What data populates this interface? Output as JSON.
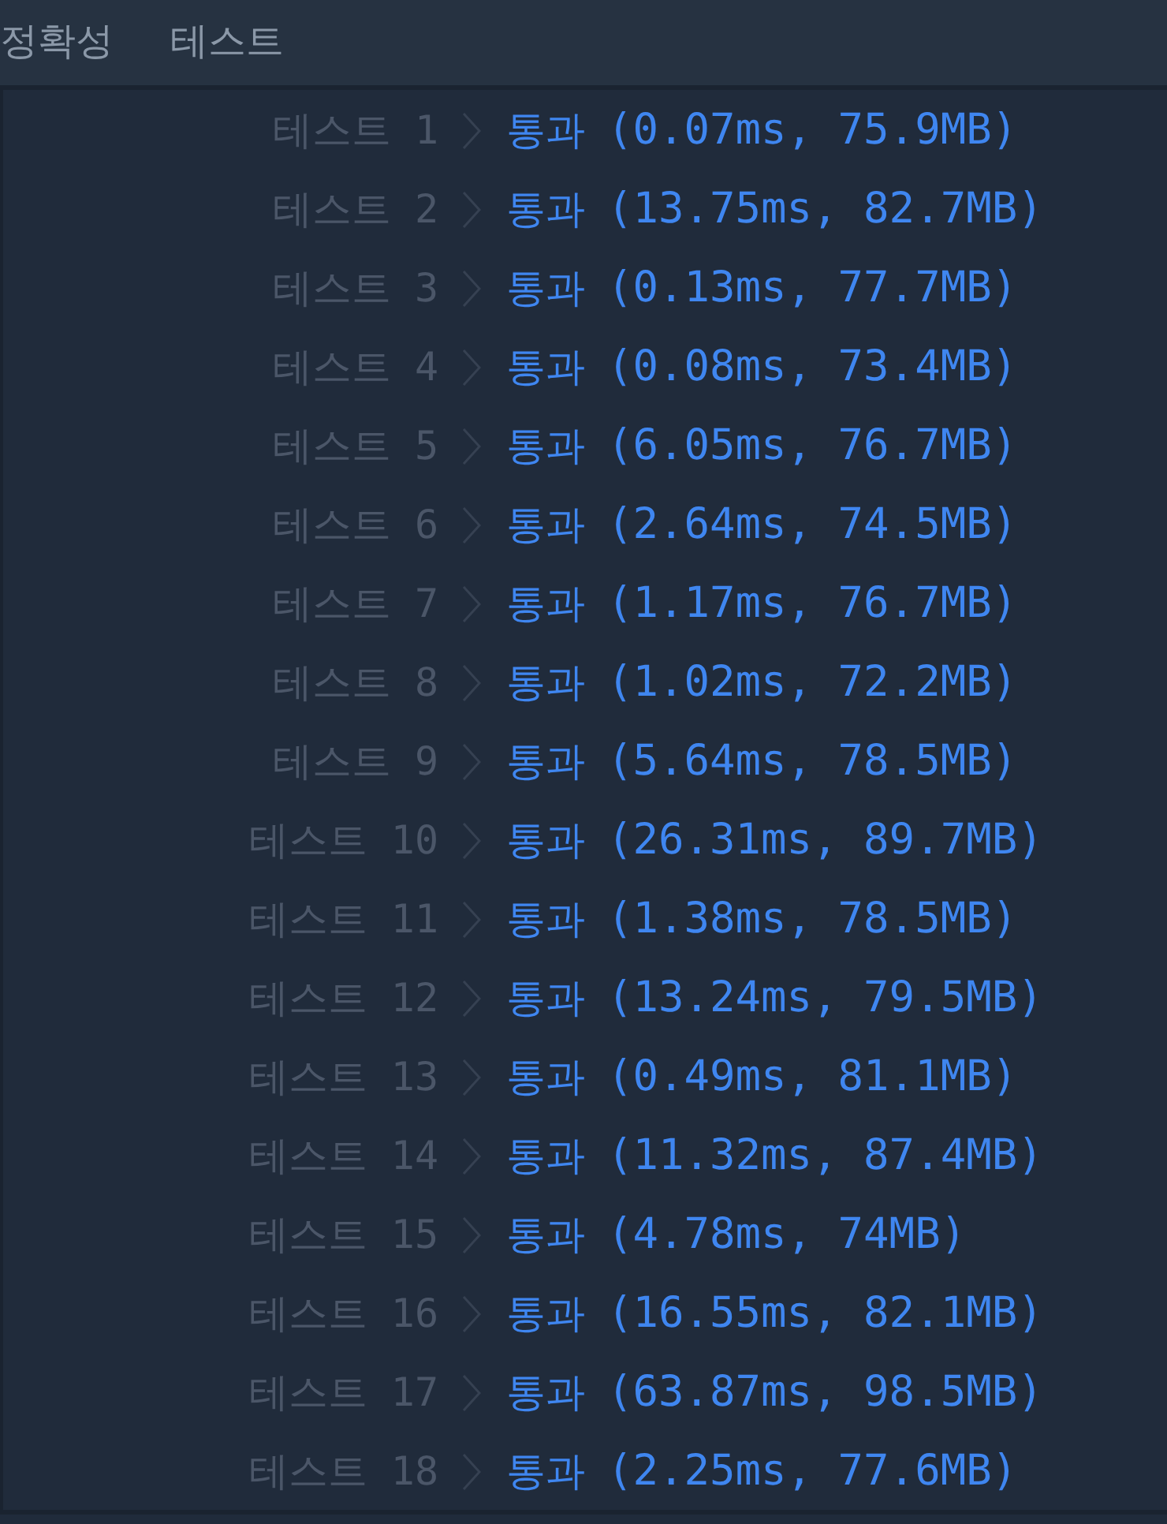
{
  "header": {
    "title": "정확성",
    "subtitle": "테스트"
  },
  "results": [
    {
      "label": "테스트 1",
      "status": "통과",
      "detail": "(0.07ms, 75.9MB)"
    },
    {
      "label": "테스트 2",
      "status": "통과",
      "detail": "(13.75ms, 82.7MB)"
    },
    {
      "label": "테스트 3",
      "status": "통과",
      "detail": "(0.13ms, 77.7MB)"
    },
    {
      "label": "테스트 4",
      "status": "통과",
      "detail": "(0.08ms, 73.4MB)"
    },
    {
      "label": "테스트 5",
      "status": "통과",
      "detail": "(6.05ms, 76.7MB)"
    },
    {
      "label": "테스트 6",
      "status": "통과",
      "detail": "(2.64ms, 74.5MB)"
    },
    {
      "label": "테스트 7",
      "status": "통과",
      "detail": "(1.17ms, 76.7MB)"
    },
    {
      "label": "테스트 8",
      "status": "통과",
      "detail": "(1.02ms, 72.2MB)"
    },
    {
      "label": "테스트 9",
      "status": "통과",
      "detail": "(5.64ms, 78.5MB)"
    },
    {
      "label": "테스트 10",
      "status": "통과",
      "detail": "(26.31ms, 89.7MB)"
    },
    {
      "label": "테스트 11",
      "status": "통과",
      "detail": "(1.38ms, 78.5MB)"
    },
    {
      "label": "테스트 12",
      "status": "통과",
      "detail": "(13.24ms, 79.5MB)"
    },
    {
      "label": "테스트 13",
      "status": "통과",
      "detail": "(0.49ms, 81.1MB)"
    },
    {
      "label": "테스트 14",
      "status": "통과",
      "detail": "(11.32ms, 87.4MB)"
    },
    {
      "label": "테스트 15",
      "status": "통과",
      "detail": "(4.78ms, 74MB)"
    },
    {
      "label": "테스트 16",
      "status": "통과",
      "detail": "(16.55ms, 82.1MB)"
    },
    {
      "label": "테스트 17",
      "status": "통과",
      "detail": "(63.87ms, 98.5MB)"
    },
    {
      "label": "테스트 18",
      "status": "통과",
      "detail": "(2.25ms, 77.6MB)"
    }
  ]
}
